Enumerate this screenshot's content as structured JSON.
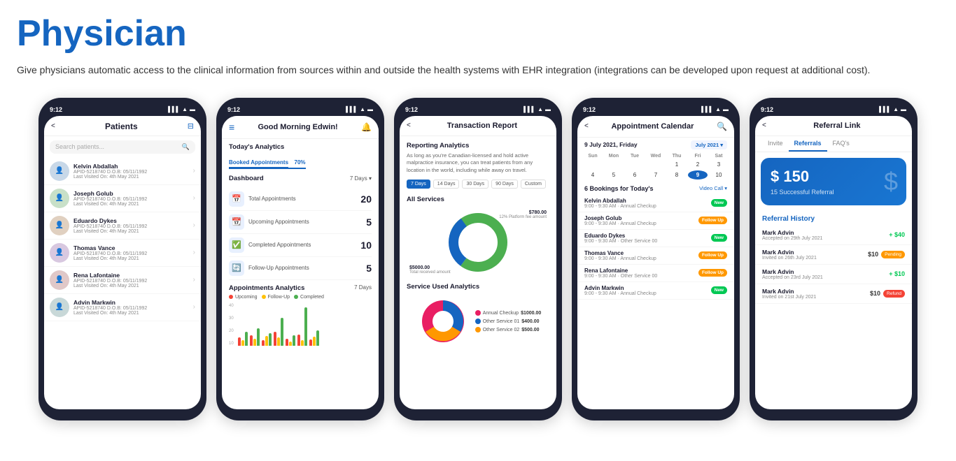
{
  "page": {
    "title": "Physician",
    "description": "Give physicians automatic access to the clinical information from sources within and outside the health systems with EHR integration (integrations can be developed upon request at additional cost)."
  },
  "phones": [
    {
      "id": "phone1",
      "screen": "patients",
      "time": "9:12",
      "header_back": "<",
      "header_title": "Patients",
      "search_placeholder": "Search patients...",
      "patients": [
        {
          "name": "Kelvin Abdallah",
          "apid": "APID-5218740   D.O.B: 05/11/1992",
          "last": "Last Visited On: 4th May 2021",
          "color": "avatar-colors"
        },
        {
          "name": "Joseph Golub",
          "apid": "APID-5218740   D.O.B: 05/11/1992",
          "last": "Last Visited On: 4th May 2021",
          "color": "avatar-colors2"
        },
        {
          "name": "Eduardo Dykes",
          "apid": "APID-5218740   D.O.B: 05/11/1992",
          "last": "Last Visited On: 4th May 2021",
          "color": "avatar-colors3"
        },
        {
          "name": "Thomas Vance",
          "apid": "APID-5218740   D.O.B: 05/11/1992",
          "last": "Last Visited On: 4th May 2021",
          "color": "avatar-colors4"
        },
        {
          "name": "Rena Lafontaine",
          "apid": "APID-5218740   D.O.B: 05/11/1992",
          "last": "Last Visited On: 4th May 2021",
          "color": "avatar-colors5"
        },
        {
          "name": "Advin Markwin",
          "apid": "APID-5218740   D.O.B: 05/11/1992",
          "last": "Last Visited On: 4th May 2021",
          "color": "avatar-colors6"
        }
      ]
    },
    {
      "id": "phone2",
      "screen": "dashboard",
      "time": "9:12",
      "greeting": "Good Morning Edwin!",
      "today_analytics": "Today's Analytics",
      "booked_tab": "Booked Appointments",
      "booked_pct": "70%",
      "dashboard_label": "Dashboard",
      "days_label": "7 Days ▼",
      "stats": [
        {
          "icon": "📅",
          "label": "Total Appointments",
          "value": "20"
        },
        {
          "icon": "📆",
          "label": "Upcoming Appointments",
          "value": "5"
        },
        {
          "icon": "✅",
          "label": "Completed Appointments",
          "value": "10"
        },
        {
          "icon": "🔄",
          "label": "Follow-Up Appointments",
          "value": "5"
        }
      ],
      "analytics_title": "Appointments Analytics",
      "analytics_days": "7 Days",
      "legends": [
        "Upcoming",
        "Follow-Up",
        "Completed"
      ],
      "legend_colors": [
        "#f44336",
        "#ffc107",
        "#4caf50"
      ]
    },
    {
      "id": "phone3",
      "screen": "transaction",
      "time": "9:12",
      "header_title": "Transaction Report",
      "reporting_title": "Reporting Analytics",
      "reporting_desc": "As long as you're Canadian-licensed and hold active malpractice insurance, you can treat patients from any location in the world, including while away on travel.",
      "filters": [
        "7 Days",
        "14 Days",
        "30 Days",
        "90 Days",
        "Custom"
      ],
      "active_filter": "7 Days",
      "all_services_title": "All Services",
      "donut_label1": "$780.00\n12% Platform fee amount",
      "donut_label2": "$5000.00\nTotal received amount",
      "service_analytics_title": "Service Used Analytics",
      "services": [
        {
          "name": "Annual Checkup",
          "value": 45,
          "color": "#e91e63",
          "amount": "$1000.00"
        },
        {
          "name": "Other Service 01",
          "value": 30,
          "color": "#1565c0",
          "amount": "$400.00"
        },
        {
          "name": "Other Service 02",
          "value": 25,
          "color": "#ff9800",
          "amount": "$500.00"
        }
      ]
    },
    {
      "id": "phone4",
      "screen": "calendar",
      "time": "9:12",
      "header_title": "Appointment Calendar",
      "date_label": "9 July 2021, Friday",
      "month_label": "July 2021 ▼",
      "day_names": [
        "Sun",
        "Mon",
        "Tue",
        "Wed",
        "Thu",
        "Fri",
        "Sat"
      ],
      "weeks": [
        [
          "",
          "",
          "",
          "",
          "1",
          "2",
          "3"
        ],
        [
          "4",
          "5",
          "6",
          "7",
          "8",
          "9",
          "10"
        ]
      ],
      "today": "9",
      "bookings_title": "6 Bookings for Today's",
      "video_label": "Video Call ▼",
      "appointments": [
        {
          "name": "Kelvin Abdallah",
          "time": "9:00 - 9:30 AM · Annual Checkup",
          "badge": "New",
          "badge_class": "badge-new"
        },
        {
          "name": "Joseph Golub",
          "time": "9:00 - 9:30 AM · Annual Checkup",
          "badge": "Follow Up",
          "badge_class": "badge-follow"
        },
        {
          "name": "Eduardo Dykes",
          "time": "9:00 - 9:30 AM · Other Service 00",
          "badge": "New",
          "badge_class": "badge-new"
        },
        {
          "name": "Thomas Vance",
          "time": "9:00 - 9:30 AM · Annual Checkup",
          "badge": "Follow Up",
          "badge_class": "badge-follow"
        },
        {
          "name": "Rena Lafontaine",
          "time": "9:00 - 9:30 AM · Other Service 00",
          "badge": "Follow Up",
          "badge_class": "badge-follow"
        },
        {
          "name": "Advin Markwin",
          "time": "9:00 - 9:30 AM · Annual Checkup",
          "badge": "New",
          "badge_class": "badge-new"
        }
      ]
    },
    {
      "id": "phone5",
      "screen": "referral",
      "time": "9:12",
      "header_title": "Referral Link",
      "tabs": [
        "Invite",
        "Referrals",
        "FAQ's"
      ],
      "active_tab": "Referrals",
      "amount": "$ 150",
      "referral_count": "15 Successful Referral",
      "history_title": "Referral History",
      "referrals": [
        {
          "name": "Mark Advin",
          "date": "Accepted on 29th July 2021",
          "amount": "+ $40",
          "type": "positive"
        },
        {
          "name": "Mark Advin",
          "date": "Invited on 26th July 2021",
          "amount": "$10",
          "badge": "Pending",
          "badge_class": "badge-pending"
        },
        {
          "name": "Mark Advin",
          "date": "Accepted on 23rd July 2021",
          "amount": "+ $10",
          "type": "positive"
        },
        {
          "name": "Mark Advin",
          "date": "Invited on 21st July 2021",
          "amount": "$10",
          "badge": "Refund",
          "badge_class": "badge-refund"
        }
      ]
    }
  ]
}
